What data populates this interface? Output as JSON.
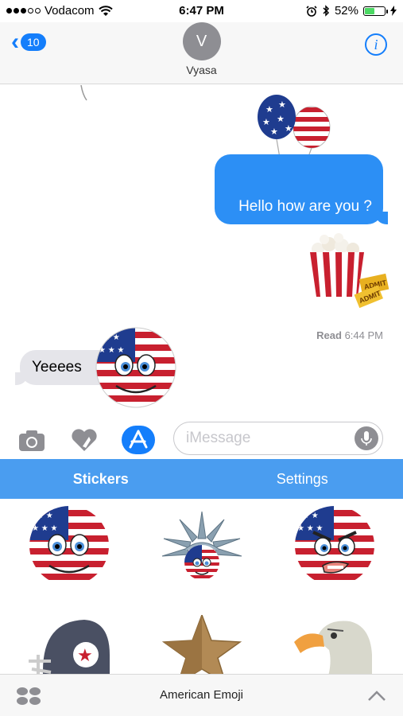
{
  "status_bar": {
    "carrier": "Vodacom",
    "time": "6:47 PM",
    "battery": "52%",
    "battery_level": 0.52
  },
  "header": {
    "back_count": "10",
    "avatar_initial": "V",
    "contact_name": "Vyasa",
    "info_label": "i"
  },
  "conversation": {
    "outgoing_message": "Hello how are you ?",
    "read_label": "Read",
    "read_time": "6:44 PM",
    "incoming_message": "Yeeees"
  },
  "input": {
    "placeholder": "iMessage"
  },
  "sticker_tabs": {
    "stickers": "Stickers",
    "settings": "Settings"
  },
  "bottom_bar": {
    "app_name": "American Emoji"
  },
  "colors": {
    "imessage_blue": "#2c8ff5",
    "tab_bar_blue": "#4a9df0",
    "incoming_gray": "#e5e5ea",
    "flag_red": "#c8202f",
    "flag_blue": "#1f3c8f"
  }
}
